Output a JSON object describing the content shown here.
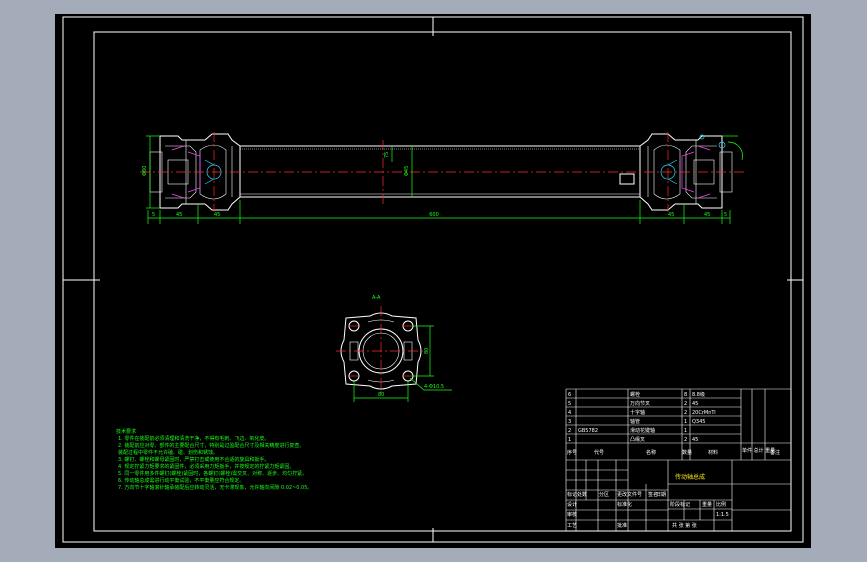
{
  "colors": {
    "background": "#a3acb8",
    "canvas": "#000000",
    "frame": "#ffffff",
    "dimension": "#19ff19",
    "centerline": "#ff2a2a",
    "title_text": "#ffe81a"
  },
  "main_view": {
    "overall_length_dim": "600",
    "small_dims": [
      "5",
      "45",
      "45",
      "45",
      "45",
      "5"
    ],
    "diameter_dim": "Φ45",
    "height_dim": "75",
    "flange_dim": "Φ80"
  },
  "section_view": {
    "label": "A-A",
    "width_dim": "80",
    "height_dim": "80",
    "hole_dim": "4-Φ10.5"
  },
  "notes": {
    "title": "技术要求",
    "lines": [
      "1. 零件在装配前必须清理和清洗干净，不得有毛刺、飞边、氧化皮。",
      "2. 装配前应对零、部件的主要配合尺寸，特别是过盈配合尺寸及相关精度进行复查。",
      "   装配过程中零件不允许磕、碰、划伤和锈蚀。",
      "3. 螺钉、螺栓和螺母紧固时，严禁打击或使用不合适的旋具和扳手。",
      "4. 规定拧紧力矩要求的紧固件，必须采用力矩扳手，并按规定的拧紧力矩紧固。",
      "5. 同一零件用多件螺钉(螺栓)紧固时，各螺钉(螺栓)需交叉、对称、逐步、均匀拧紧。",
      "6. 传动轴总成需进行动平衡试验，不平衡量应符合规定。",
      "7. 万向节十字轴滚针轴承装配后应转动灵活，无卡滞现象，允许轴向间隙 0.02~0.05。"
    ]
  },
  "bom": [
    {
      "no": "6",
      "name": "螺栓",
      "qty": "8",
      "material": "8.8级"
    },
    {
      "no": "5",
      "name": "万向节叉",
      "qty": "2",
      "material": "45"
    },
    {
      "no": "4",
      "name": "十字轴",
      "qty": "2",
      "material": "20CrMnTi"
    },
    {
      "no": "3",
      "name": "轴管",
      "qty": "1",
      "material": "Q345"
    },
    {
      "no": "2",
      "code": "GB5782",
      "name": "滑动花键轴",
      "qty": "1",
      "material": ""
    },
    {
      "no": "1",
      "name": "凸缘叉",
      "qty": "2",
      "material": "45"
    }
  ],
  "bom_header": {
    "no": "序号",
    "code": "代号",
    "name": "名称",
    "qty": "数量",
    "material": "材料",
    "weight": "单件 总计 重量",
    "remark": "备注"
  },
  "title_block": {
    "drawing_name": "传动轴总成",
    "scale": "1:1.5",
    "scale_label": "比例",
    "weight_label": "重量",
    "stage_label": "阶段标记",
    "sheet_label": "共 张 第 张",
    "designer": "设计",
    "checker": "审核",
    "process": "工艺",
    "standard": "标准化",
    "approve": "批准",
    "date": "日期",
    "signature": "签名",
    "mark": "标记",
    "count": "处数",
    "zone": "分区",
    "change_doc": "更改文件号"
  }
}
